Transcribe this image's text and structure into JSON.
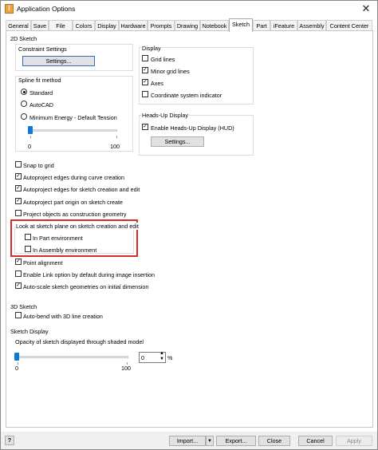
{
  "window": {
    "title": "Application Options",
    "close_glyph": "✕"
  },
  "tabs": [
    {
      "label": "General"
    },
    {
      "label": "Save"
    },
    {
      "label": "File"
    },
    {
      "label": "Colors"
    },
    {
      "label": "Display"
    },
    {
      "label": "Hardware"
    },
    {
      "label": "Prompts"
    },
    {
      "label": "Drawing"
    },
    {
      "label": "Notebook"
    },
    {
      "label": "Sketch"
    },
    {
      "label": "Part"
    },
    {
      "label": "iFeature"
    },
    {
      "label": "Assembly"
    },
    {
      "label": "Content Center"
    }
  ],
  "active_tab": "Sketch",
  "sketch2d": {
    "heading": "2D Sketch",
    "constraint": {
      "title": "Constraint Settings",
      "button": "Settings..."
    },
    "spline": {
      "title": "Spline fit method",
      "options": [
        "Standard",
        "AutoCAD",
        "Minimum Energy - Default Tension"
      ],
      "selected": "Standard",
      "slider": {
        "min_label": "0",
        "max_label": "100",
        "value": 0
      }
    },
    "display": {
      "title": "Display",
      "items": [
        {
          "label": "Grid lines",
          "checked": false
        },
        {
          "label": "Minor grid lines",
          "checked": true
        },
        {
          "label": "Axes",
          "checked": true
        },
        {
          "label": "Coordinate system indicator",
          "checked": false
        }
      ]
    },
    "hud": {
      "title": "Heads-Up Display",
      "label": "Enable Heads-Up Display (HUD)",
      "checked": true,
      "button": "Settings..."
    },
    "options": [
      {
        "label": "Snap to grid",
        "checked": false
      },
      {
        "label": "Autoproject edges during curve creation",
        "checked": true
      },
      {
        "label": "Autoproject edges for sketch creation and edit",
        "checked": true
      },
      {
        "label": "Autoproject part origin on sketch create",
        "checked": true
      },
      {
        "label": "Project objects as construction geometry",
        "checked": false
      }
    ],
    "look_at": {
      "title": "Look at sketch plane on sketch creation and edit",
      "items": [
        {
          "label": "In Part environment",
          "checked": false
        },
        {
          "label": "In Assembly environment",
          "checked": false
        }
      ]
    },
    "options2": [
      {
        "label": "Point alignment",
        "checked": true
      },
      {
        "label": "Enable Link option by default during image insertion",
        "checked": false
      },
      {
        "label": "Auto-scale sketch geometries on initial dimension",
        "checked": true
      }
    ]
  },
  "sketch3d": {
    "heading": "3D Sketch",
    "autobend": {
      "label": "Auto-bend with 3D line creation",
      "checked": false
    }
  },
  "sketch_display": {
    "heading": "Sketch Display",
    "opacity_label": "Opacity of sketch displayed through shaded model",
    "slider": {
      "min_label": "0",
      "max_label": "100",
      "value": 0
    },
    "spin_value": "0",
    "unit": "%"
  },
  "footer": {
    "help": "?",
    "import": "Import...",
    "export": "Export...",
    "close": "Close",
    "cancel": "Cancel",
    "apply": "Apply"
  },
  "colors": {
    "accent": "#0a7bd8",
    "highlight": "#d32c2c",
    "focus": "#2f6fb8"
  },
  "icons": [
    "app-icon",
    "close-icon",
    "help-icon",
    "dropdown-arrow-icon",
    "spin-up-icon",
    "spin-down-icon",
    "check-icon"
  ]
}
